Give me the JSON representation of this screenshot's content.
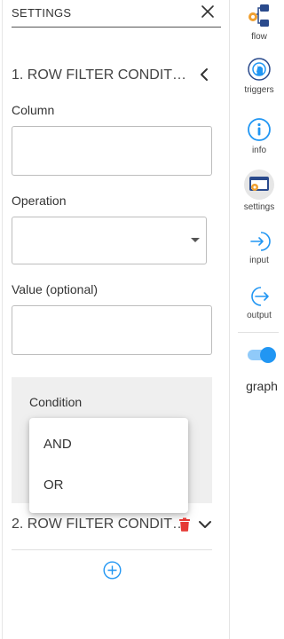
{
  "header": {
    "title": "SETTINGS"
  },
  "sections": [
    {
      "title": "1. ROW FILTER CONDIT…"
    },
    {
      "title": "2. ROW FILTER CONDIT…"
    }
  ],
  "form": {
    "column_label": "Column",
    "column_value": "",
    "operation_label": "Operation",
    "operation_value": "",
    "value_label": "Value (optional)",
    "value_value": "",
    "condition_label": "Condition"
  },
  "condition_options": [
    "AND",
    "OR"
  ],
  "sidebar": {
    "items": [
      {
        "label": "flow",
        "icon": "flow-icon"
      },
      {
        "label": "triggers",
        "icon": "triggers-icon"
      },
      {
        "label": "info",
        "icon": "info-icon"
      },
      {
        "label": "settings",
        "icon": "settings-icon",
        "active": true
      },
      {
        "label": "input",
        "icon": "input-icon"
      },
      {
        "label": "output",
        "icon": "output-icon"
      }
    ],
    "toggle_label": "graph",
    "toggle_on": true
  },
  "colors": {
    "accent": "#2196f3",
    "delete": "#e53935",
    "active_bg": "#e6e6e6",
    "panel_bg": "#efefef"
  }
}
